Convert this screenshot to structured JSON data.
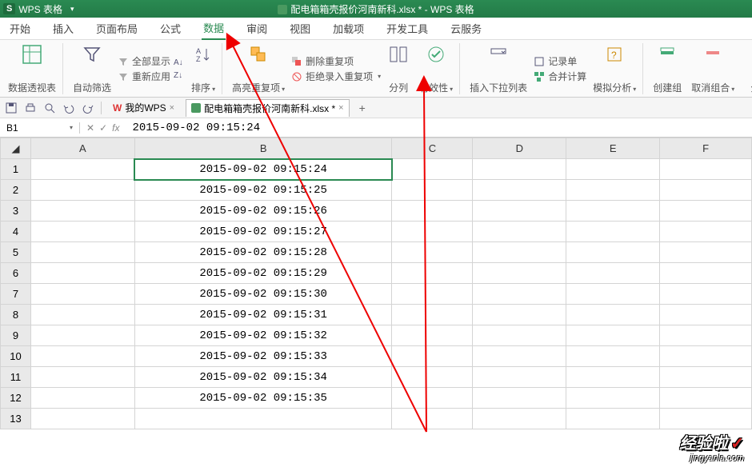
{
  "title_bar": {
    "logo": "S",
    "app_name": "WPS 表格",
    "document_title": "配电箱箱壳报价河南新科.xlsx * - WPS 表格"
  },
  "menu": {
    "tabs": [
      "开始",
      "插入",
      "页面布局",
      "公式",
      "数据",
      "审阅",
      "视图",
      "加载项",
      "开发工具",
      "云服务"
    ],
    "active_index": 4
  },
  "ribbon": {
    "pivot": "数据透视表",
    "autofilter": "自动筛选",
    "show_all": "全部显示",
    "reapply": "重新应用",
    "sort": "排序",
    "highlight_dup": "高亮重复项",
    "delete_dup": "删除重复项",
    "reject_dup": "拒绝录入重复项",
    "text_to_cols": "分列",
    "validation": "有效性",
    "dropdown": "插入下拉列表",
    "record_form": "记录单",
    "consolidate": "合并计算",
    "whatif": "模拟分析",
    "group": "创建组",
    "ungroup": "取消组合",
    "subtotal": "分"
  },
  "qat": {
    "mywps": "我的WPS",
    "sheet_name": "配电箱箱壳报价河南新科.xlsx *"
  },
  "formula_bar": {
    "cell_ref": "B1",
    "value": "2015-09-02 09:15:24"
  },
  "columns": [
    "A",
    "B",
    "C",
    "D",
    "E",
    "F"
  ],
  "rows": [
    {
      "n": 1,
      "b": "2015-09-02 09:15:24"
    },
    {
      "n": 2,
      "b": "2015-09-02 09:15:25"
    },
    {
      "n": 3,
      "b": "2015-09-02 09:15:26"
    },
    {
      "n": 4,
      "b": "2015-09-02 09:15:27"
    },
    {
      "n": 5,
      "b": "2015-09-02 09:15:28"
    },
    {
      "n": 6,
      "b": "2015-09-02 09:15:29"
    },
    {
      "n": 7,
      "b": "2015-09-02 09:15:30"
    },
    {
      "n": 8,
      "b": "2015-09-02 09:15:31"
    },
    {
      "n": 9,
      "b": "2015-09-02 09:15:32"
    },
    {
      "n": 10,
      "b": "2015-09-02 09:15:33"
    },
    {
      "n": 11,
      "b": "2015-09-02 09:15:34"
    },
    {
      "n": 12,
      "b": "2015-09-02 09:15:35"
    },
    {
      "n": 13,
      "b": ""
    }
  ],
  "watermark": {
    "line1": "经验啦",
    "check": "✓",
    "line2": "jingyanla.com"
  }
}
